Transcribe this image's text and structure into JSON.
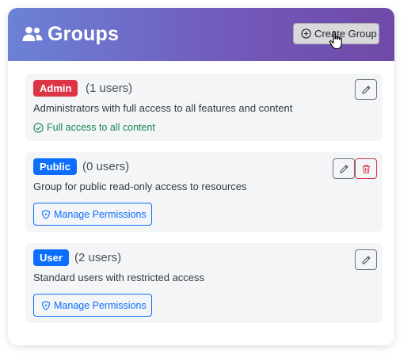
{
  "header": {
    "title": "Groups",
    "create_label": "Create Group"
  },
  "groups": [
    {
      "badge": "Admin",
      "count": "(1 users)",
      "description": "Administrators with full access to all features and content",
      "note": "Full access to all content"
    },
    {
      "badge": "Public",
      "count": "(0 users)",
      "description": "Group for public read-only access to resources",
      "action_label": "Manage Permissions"
    },
    {
      "badge": "User",
      "count": "(2 users)",
      "description": "Standard users with restricted access",
      "action_label": "Manage Permissions"
    }
  ],
  "icons": {
    "header": "users-icon",
    "create": "plus-circle-icon",
    "edit": "pencil-icon",
    "delete": "trash-icon",
    "check": "check-circle-icon",
    "permissions": "shield-icon",
    "cursor": "hand-pointer-icon"
  },
  "colors": {
    "header_gradient_start": "#6b82d6",
    "header_gradient_end": "#6f4aa8",
    "admin_badge": "#dc3545",
    "primary": "#0d6efd",
    "success": "#198754",
    "card_bg": "#f4f5f7"
  }
}
